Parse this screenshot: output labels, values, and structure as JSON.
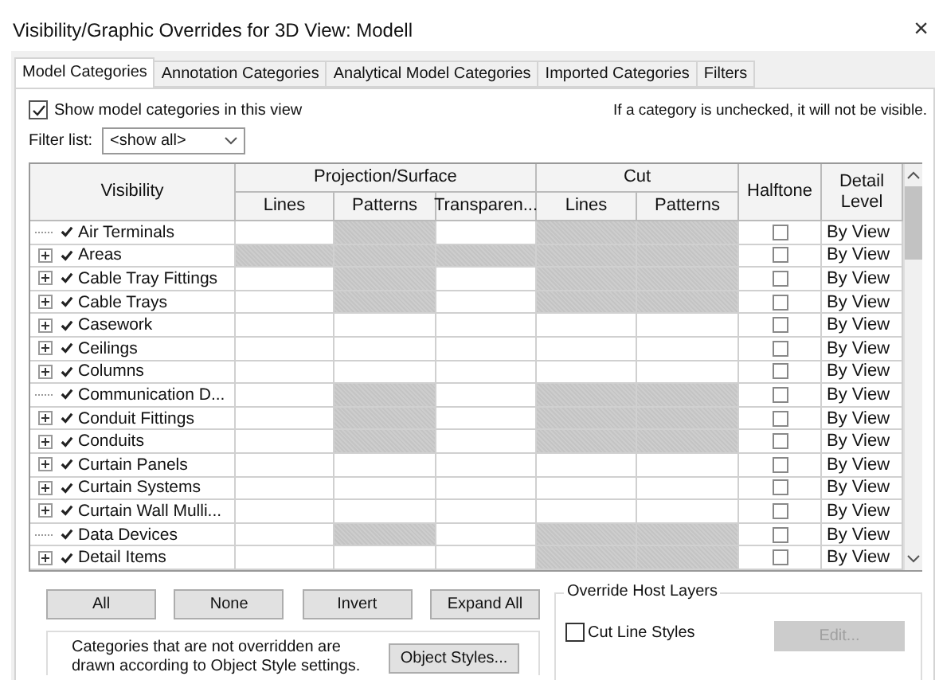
{
  "window": {
    "title": "Visibility/Graphic Overrides for 3D View: Modell",
    "close": "×"
  },
  "tabs": [
    {
      "label": "Model Categories",
      "selected": true
    },
    {
      "label": "Annotation Categories",
      "selected": false
    },
    {
      "label": "Analytical Model Categories",
      "selected": false
    },
    {
      "label": "Imported Categories",
      "selected": false
    },
    {
      "label": "Filters",
      "selected": false
    }
  ],
  "show_categories": {
    "label": "Show model categories in this view",
    "checked": true
  },
  "hint": "If a category is unchecked, it will not be visible.",
  "filter": {
    "label": "Filter list:",
    "value": "<show all>"
  },
  "table": {
    "columns": {
      "visibility": "Visibility",
      "projection": "Projection/Surface",
      "cut": "Cut",
      "halftone": "Halftone",
      "detail": "Detail Level",
      "sub": [
        "Lines",
        "Patterns",
        "Transparen...",
        "Lines",
        "Patterns"
      ]
    },
    "rows": [
      {
        "name": "Air Terminals",
        "expandable": false,
        "visible": true,
        "shaded": [
          false,
          true,
          false,
          true,
          true
        ],
        "halftone": false,
        "detail": "By View"
      },
      {
        "name": "Areas",
        "expandable": true,
        "visible": true,
        "shaded": [
          true,
          true,
          true,
          true,
          true
        ],
        "halftone": false,
        "detail": "By View"
      },
      {
        "name": "Cable Tray Fittings",
        "expandable": true,
        "visible": true,
        "shaded": [
          false,
          true,
          false,
          true,
          true
        ],
        "halftone": false,
        "detail": "By View"
      },
      {
        "name": "Cable Trays",
        "expandable": true,
        "visible": true,
        "shaded": [
          false,
          true,
          false,
          true,
          true
        ],
        "halftone": false,
        "detail": "By View"
      },
      {
        "name": "Casework",
        "expandable": true,
        "visible": true,
        "shaded": [
          false,
          false,
          false,
          false,
          false
        ],
        "halftone": false,
        "detail": "By View"
      },
      {
        "name": "Ceilings",
        "expandable": true,
        "visible": true,
        "shaded": [
          false,
          false,
          false,
          false,
          false
        ],
        "halftone": false,
        "detail": "By View"
      },
      {
        "name": "Columns",
        "expandable": true,
        "visible": true,
        "shaded": [
          false,
          false,
          false,
          false,
          false
        ],
        "halftone": false,
        "detail": "By View"
      },
      {
        "name": "Communication D...",
        "expandable": false,
        "visible": true,
        "shaded": [
          false,
          true,
          false,
          true,
          true
        ],
        "halftone": false,
        "detail": "By View"
      },
      {
        "name": "Conduit Fittings",
        "expandable": true,
        "visible": true,
        "shaded": [
          false,
          true,
          false,
          true,
          true
        ],
        "halftone": false,
        "detail": "By View"
      },
      {
        "name": "Conduits",
        "expandable": true,
        "visible": true,
        "shaded": [
          false,
          true,
          false,
          true,
          true
        ],
        "halftone": false,
        "detail": "By View"
      },
      {
        "name": "Curtain Panels",
        "expandable": true,
        "visible": true,
        "shaded": [
          false,
          false,
          false,
          false,
          false
        ],
        "halftone": false,
        "detail": "By View"
      },
      {
        "name": "Curtain Systems",
        "expandable": true,
        "visible": true,
        "shaded": [
          false,
          false,
          false,
          false,
          false
        ],
        "halftone": false,
        "detail": "By View"
      },
      {
        "name": "Curtain Wall Mulli...",
        "expandable": true,
        "visible": true,
        "shaded": [
          false,
          false,
          false,
          false,
          false
        ],
        "halftone": false,
        "detail": "By View"
      },
      {
        "name": "Data Devices",
        "expandable": false,
        "visible": true,
        "shaded": [
          false,
          true,
          false,
          true,
          true
        ],
        "halftone": false,
        "detail": "By View"
      },
      {
        "name": "Detail Items",
        "expandable": true,
        "visible": true,
        "shaded": [
          false,
          false,
          false,
          true,
          true
        ],
        "halftone": false,
        "detail": "By View"
      }
    ]
  },
  "buttons": [
    "All",
    "None",
    "Invert",
    "Expand All"
  ],
  "note": "Categories that are not overridden are drawn according to Object Style settings.",
  "object_styles": "Object Styles...",
  "host_layers": {
    "title": "Override Host Layers",
    "option": "Cut Line Styles",
    "checked": false,
    "edit": "Edit...",
    "edit_disabled": true
  }
}
